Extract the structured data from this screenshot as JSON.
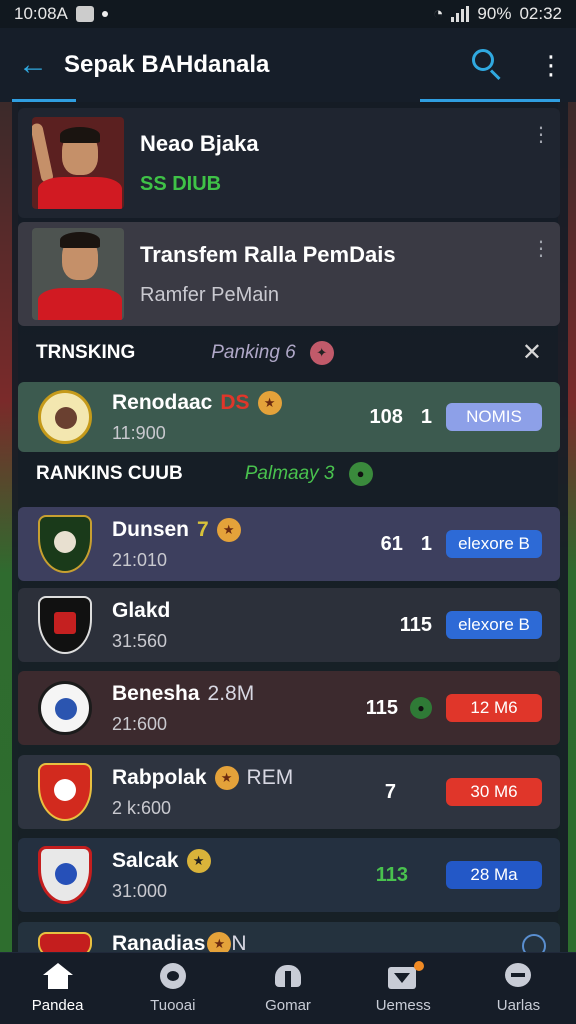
{
  "status_bar": {
    "time_left": "10:08A",
    "battery": "90%",
    "clock": "02:32"
  },
  "app_bar": {
    "title": "Sepak BAHdanala"
  },
  "news": [
    {
      "title": "Neao Bjaka",
      "subtitle": "SS DIUB"
    },
    {
      "title": "Transfem Ralla PemDais",
      "subtitle": "Ramfer PeMain"
    }
  ],
  "trending": {
    "label": "TRNSKING",
    "mid": "Panking 6"
  },
  "featured": {
    "name": "Renodaac",
    "tag": "DS",
    "sub": "11:900",
    "score": "108",
    "rank": "1",
    "pill": "NOMIS"
  },
  "rankings": {
    "label": "RANKINS CUUB",
    "mid": "Palmaay 3"
  },
  "clubs": [
    {
      "name": "Dunsen",
      "tag": "7",
      "sub": "21:010",
      "score": "61",
      "rank": "1",
      "pill": "elexore B"
    },
    {
      "name": "Glakd",
      "tag": "",
      "sub": "31:560",
      "score": "115",
      "rank": "",
      "pill": "elexore B"
    },
    {
      "name": "Benesha",
      "extra": "2.8M",
      "sub": "21:600",
      "score": "115",
      "rank": "",
      "pill": "12 M6"
    },
    {
      "name": "Rabpolak",
      "extra": "REM",
      "sub": "2 k:600",
      "score": "7",
      "rank": "",
      "pill": "30 M6"
    },
    {
      "name": "Salcak",
      "extra": "",
      "sub": "31:000",
      "score": "113",
      "rank": "",
      "pill": "28 Ma"
    },
    {
      "name": "Ranadias",
      "extra": "N",
      "sub": "",
      "score": "",
      "rank": "",
      "pill": ""
    }
  ],
  "bottom_nav": [
    {
      "label": "Pandea",
      "icon": "home-icon"
    },
    {
      "label": "Tuooai",
      "icon": "ball-icon"
    },
    {
      "label": "Gomar",
      "icon": "game-icon"
    },
    {
      "label": "Uemess",
      "icon": "video-icon"
    },
    {
      "label": "Uarlas",
      "icon": "chat-icon"
    }
  ],
  "colors": {
    "accent": "#2f9ee0",
    "green": "#49c24e",
    "red": "#e0362a",
    "blue": "#2d6ad6"
  }
}
